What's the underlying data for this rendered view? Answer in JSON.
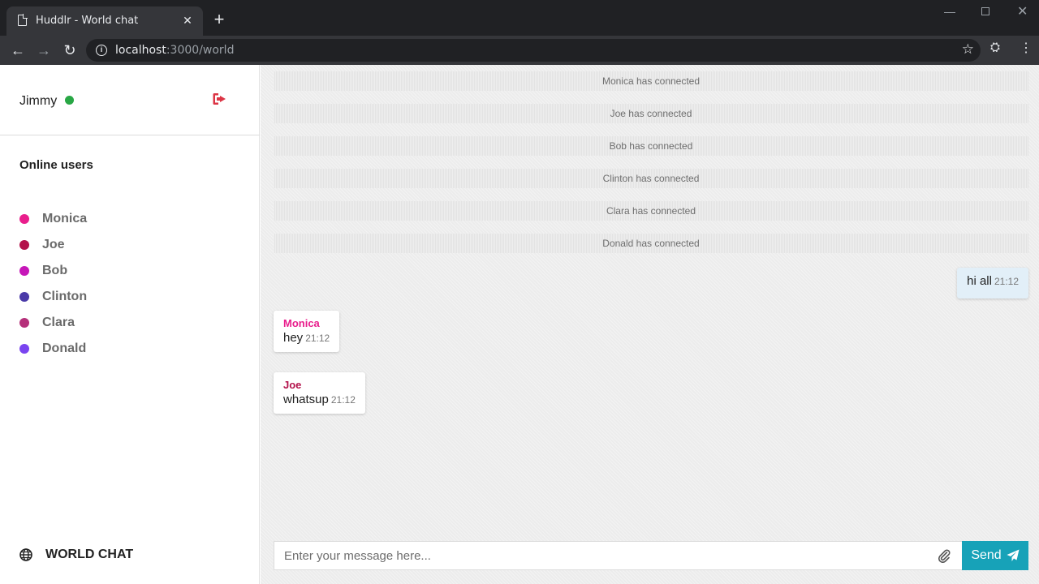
{
  "browser": {
    "tab_title": "Huddlr - World chat",
    "url_host": "localhost",
    "url_path": ":3000/world"
  },
  "sidebar": {
    "username": "Jimmy",
    "status_color": "#28a745",
    "online_heading": "Online users",
    "online_users": [
      {
        "name": "Monica",
        "color": "#e91e8c"
      },
      {
        "name": "Joe",
        "color": "#b3124b"
      },
      {
        "name": "Bob",
        "color": "#c617b8"
      },
      {
        "name": "Clinton",
        "color": "#4a3aa8"
      },
      {
        "name": "Clara",
        "color": "#b5307a"
      },
      {
        "name": "Donald",
        "color": "#7a44f0"
      }
    ],
    "world_chat_label": "WORLD CHAT"
  },
  "chat": {
    "system_messages": [
      "Monica has connected",
      "Joe has connected",
      "Bob has connected",
      "Clinton has connected",
      "Clara has connected",
      "Donald has connected"
    ],
    "own_message": {
      "text": "hi all",
      "time": "21:12"
    },
    "messages": [
      {
        "sender": "Monica",
        "sender_color": "#e91e8c",
        "text": "hey",
        "time": "21:12"
      },
      {
        "sender": "Joe",
        "sender_color": "#b3124b",
        "text": "whatsup",
        "time": "21:12"
      }
    ],
    "input_placeholder": "Enter your message here...",
    "send_label": "Send",
    "send_color": "#17a2b8"
  }
}
